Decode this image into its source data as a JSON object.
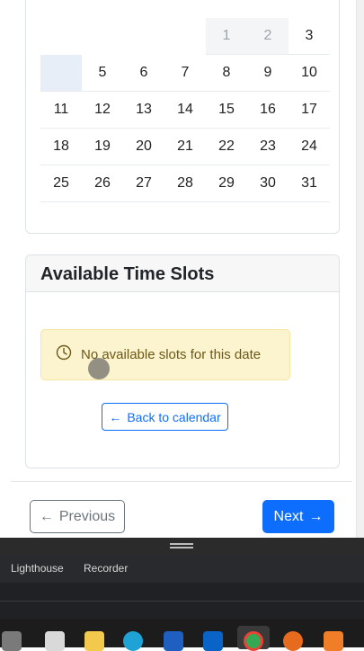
{
  "calendar": {
    "weeks": [
      [
        "",
        "",
        "",
        "",
        "1",
        "2",
        "3"
      ],
      [
        "",
        "5",
        "6",
        "7",
        "8",
        "9",
        "10"
      ],
      [
        "11",
        "12",
        "13",
        "14",
        "15",
        "16",
        "17"
      ],
      [
        "18",
        "19",
        "20",
        "21",
        "22",
        "23",
        "24"
      ],
      [
        "25",
        "26",
        "27",
        "28",
        "29",
        "30",
        "31"
      ]
    ]
  },
  "slots": {
    "title": "Available Time Slots",
    "empty_message": "No available slots for this date",
    "back_label": "Back to calendar"
  },
  "nav": {
    "previous_label": "Previous",
    "next_label": "Next"
  },
  "devtools": {
    "tabs": [
      "Lighthouse",
      "Recorder"
    ]
  },
  "colors": {
    "primary": "#0d6efd",
    "alert_bg": "#fcf3cf",
    "secondary": "#6c757d"
  },
  "icons": [
    "clock-icon",
    "arrow-left-icon",
    "arrow-right-icon"
  ],
  "taskbar": {
    "apps": [
      "file-explorer-icon",
      "terminal-icon",
      "folder-icon",
      "edge-icon",
      "store-icon",
      "outlook-icon",
      "chrome-icon",
      "firefox-icon",
      "xampp-icon"
    ]
  }
}
